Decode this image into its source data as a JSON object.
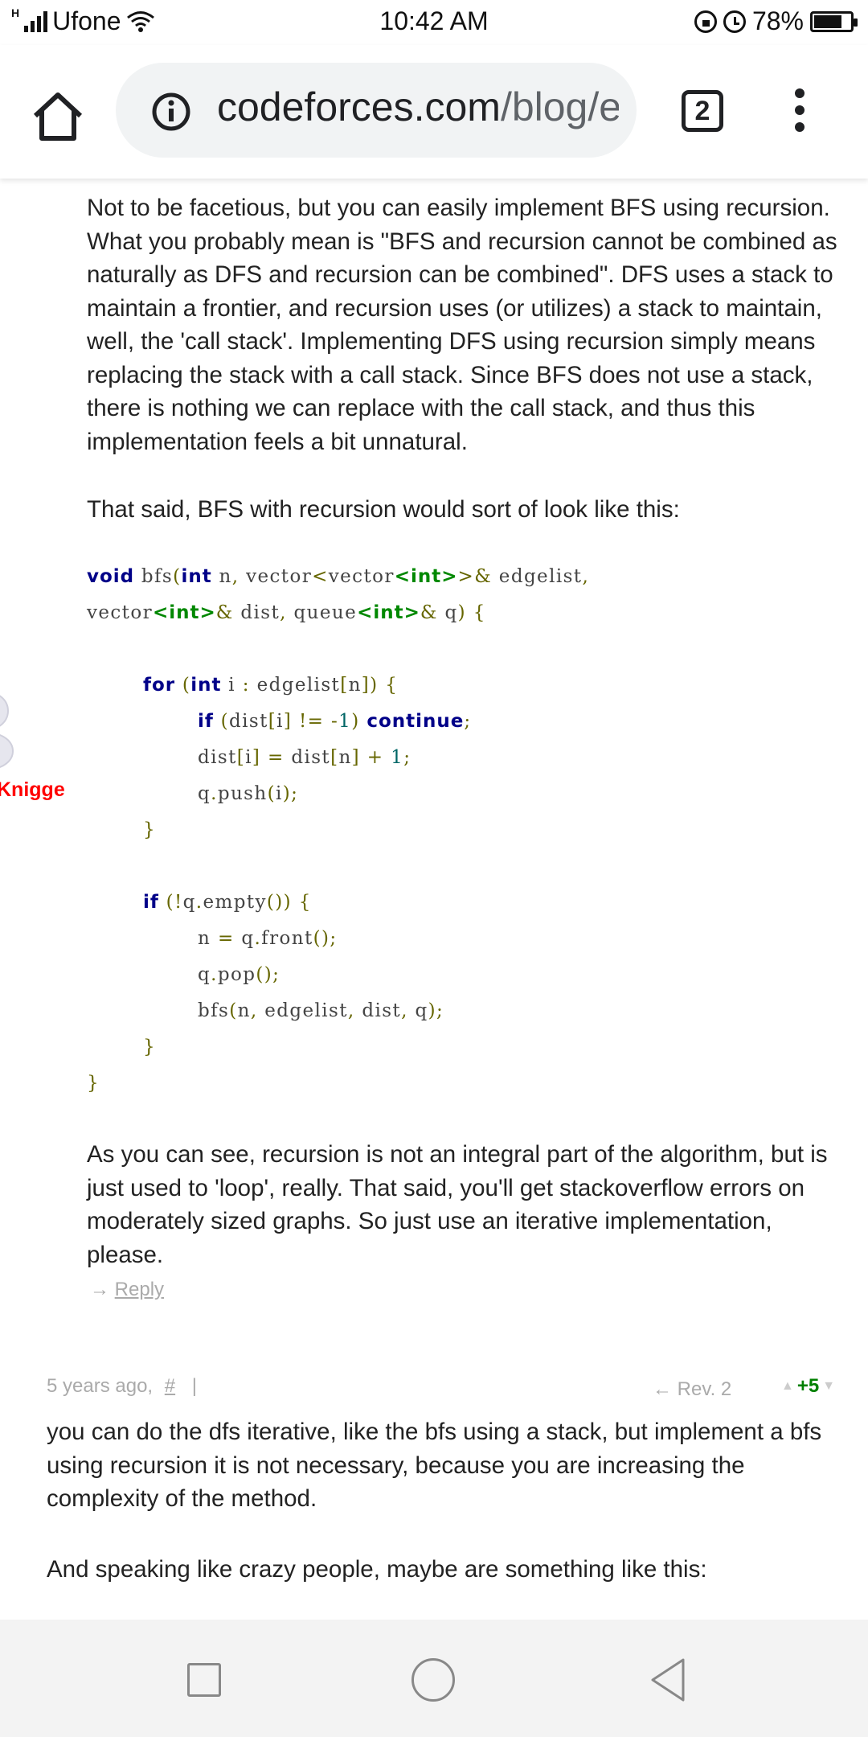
{
  "status_bar": {
    "carrier": "Ufone",
    "network_marker": "H",
    "time": "10:42 AM",
    "battery_percent": "78%",
    "battery_level": 0.78,
    "icons": [
      "signal-icon",
      "wifi-icon",
      "lock-rotation-icon",
      "alarm-icon",
      "battery-icon"
    ]
  },
  "browser": {
    "url_domain": "codeforces.com",
    "url_path": "/blog/e",
    "tab_count": "2"
  },
  "comment1": {
    "para1": "Not to be facetious, but you can easily implement BFS using recursion. What you probably mean is \"BFS and recursion cannot be combined as naturally as DFS and recursion can be combined\". DFS uses a stack to maintain a frontier, and recursion uses (or utilizes) a stack to maintain, well, the 'call stack'. Implementing DFS using recursion simply means replacing the stack with a call stack. Since BFS does not use a stack, there is nothing we can replace with the call stack, and thus this implementation feels a bit unnatural.",
    "para2": "That said, BFS with recursion would sort of look like this:",
    "para3": "As you can see, recursion is not an integral part of the algorithm, but is just used to 'loop', really. That said, you'll get stackoverflow errors on moderately sized graphs. So just use an iterative implementation, please.",
    "reply_arrow": "→",
    "reply_label": "Reply",
    "author_partial": "Knigge"
  },
  "comment2": {
    "time_ago": "5 years ago,",
    "hash": "#",
    "separator": "|",
    "revision": "← Rev. 2",
    "score": "+5",
    "para1": "you can do the dfs iterative, like the bfs using a stack, but implement a bfs using recursion it is not necessary, because you are increasing the complexity of the method.",
    "para2": "And speaking like crazy people, maybe are something like this:"
  },
  "colors": {
    "keyword": "#000088",
    "type": "#008800",
    "punct": "#666600",
    "number": "#006666",
    "author_red": "#ff0000",
    "score_green": "#008000"
  }
}
